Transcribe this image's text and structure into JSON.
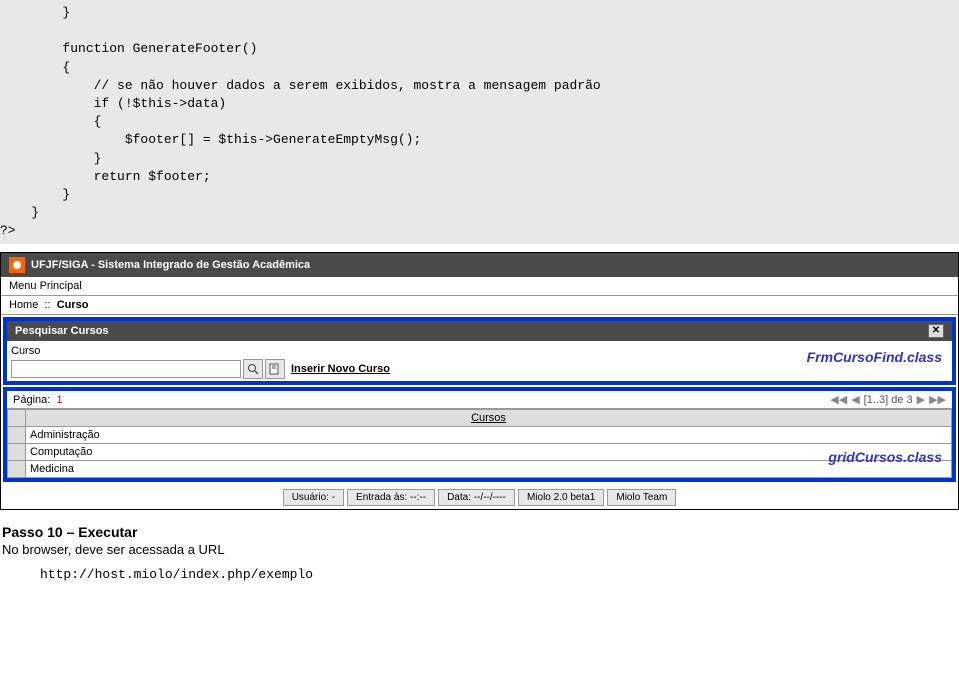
{
  "code": "        }\n\n        function GenerateFooter()\n        {\n            // se não houver dados a serem exibidos, mostra a mensagem padrão\n            if (!$this->data)\n            {\n                $footer[] = $this->GenerateEmptyMsg();\n            }\n            return $footer;\n        }\n    }\n?>",
  "appHeader": "UFJF/SIGA - Sistema Integrado de Gestão Acadêmica",
  "menuPrincipal": "Menu Principal",
  "breadcrumb": {
    "home": "Home",
    "sep": "::",
    "current": "Curso"
  },
  "search": {
    "title": "Pesquisar Cursos",
    "fieldLabel": "Curso",
    "insertLabel": "Inserir Novo Curso"
  },
  "annotation1": "FrmCursoFind.class",
  "grid": {
    "pagerLabel": "Página:",
    "pagerNum": "1",
    "pagerInfo": "[1..3] de 3",
    "header": "Cursos",
    "rows": [
      "Administração",
      "Computação",
      "Medicina"
    ]
  },
  "annotation2": "gridCursos.class",
  "status": {
    "usuario": "Usuário: -",
    "entrada": "Entrada às: --:--",
    "data": "Data: --/--/----",
    "version": "Miolo 2.0 beta1",
    "team": "Miolo Team"
  },
  "step": {
    "title": "Passo 10 – Executar",
    "text": "No browser, deve ser acessada a URL",
    "url": "http://host.miolo/index.php/exemplo"
  }
}
